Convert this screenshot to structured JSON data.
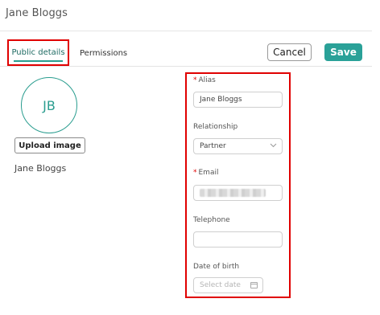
{
  "header": {
    "title": "Jane Bloggs"
  },
  "tabs": [
    {
      "label": "Public details",
      "active": true
    },
    {
      "label": "Permissions",
      "active": false
    }
  ],
  "actions": {
    "cancel_label": "Cancel",
    "save_label": "Save"
  },
  "profile": {
    "initials": "JB",
    "upload_label": "Upload image",
    "display_name": "Jane Bloggs"
  },
  "form": {
    "alias": {
      "label": "Alias",
      "required": true,
      "value": "Jane Bloggs"
    },
    "relationship": {
      "label": "Relationship",
      "value": "Partner",
      "icon": "chevron-down-icon"
    },
    "email": {
      "label": "Email",
      "required": true,
      "value": ""
    },
    "telephone": {
      "label": "Telephone",
      "value": ""
    },
    "dob": {
      "label": "Date of birth",
      "placeholder": "Select date",
      "icon": "calendar-icon"
    }
  },
  "colors": {
    "accent": "#2aa198",
    "highlight": "#e00000",
    "required": "#e00000"
  }
}
